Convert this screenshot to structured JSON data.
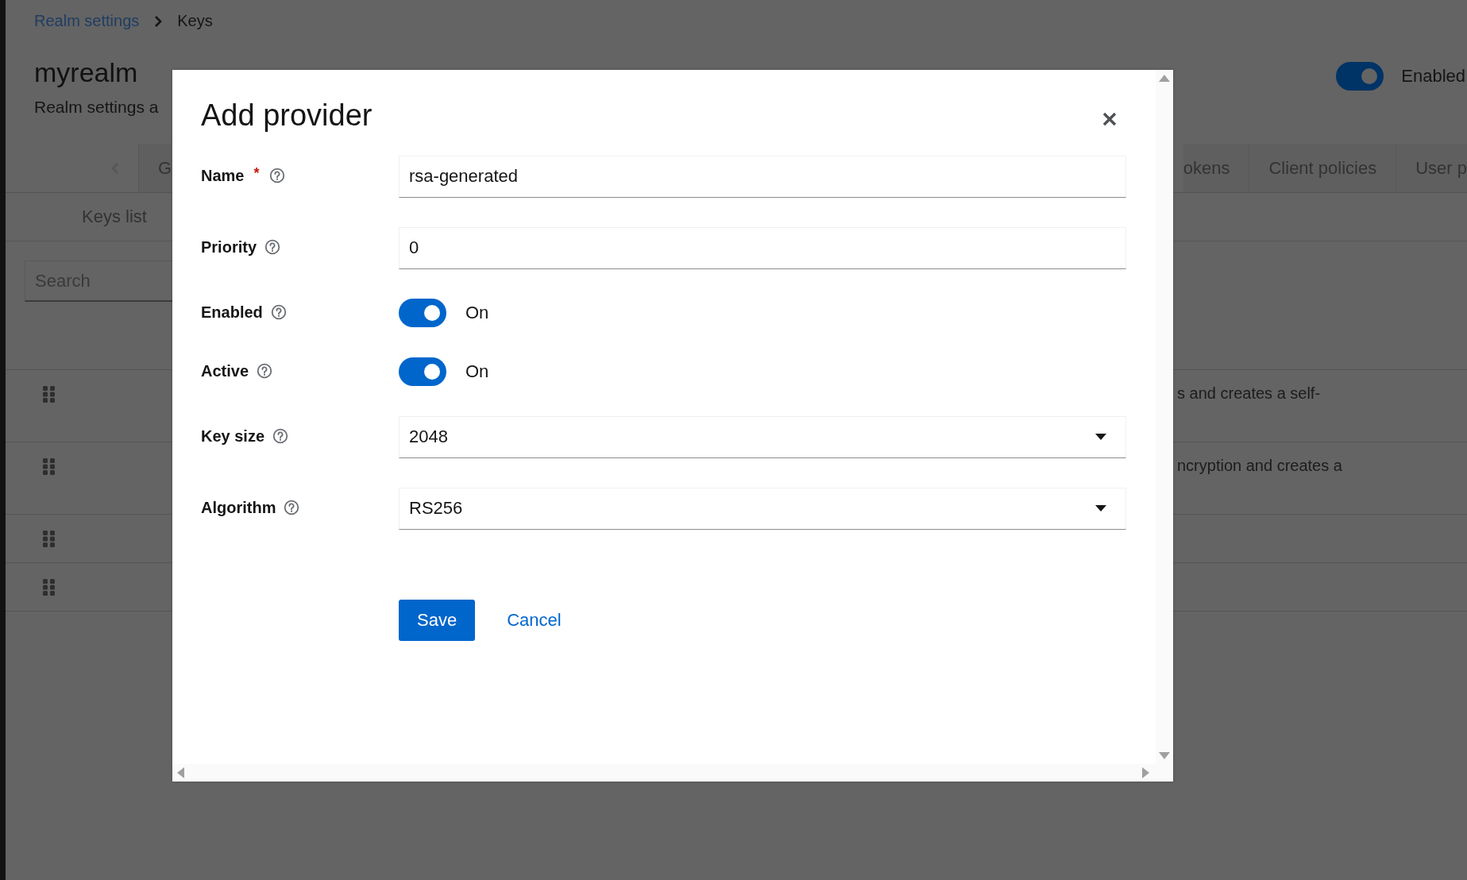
{
  "breadcrumb": [
    {
      "label": "Realm settings",
      "kind": "link"
    },
    {
      "label": "Keys",
      "kind": "current"
    }
  ],
  "header": {
    "title": "myrealm",
    "subtitle": "Realm settings a",
    "toggle": {
      "label": "Enabled",
      "on": true
    }
  },
  "tabs_left": [
    {
      "label": "G"
    }
  ],
  "tabs_right": [
    {
      "label": "okens"
    },
    {
      "label": "Client policies"
    },
    {
      "label": "User p"
    }
  ],
  "subtabs": [
    {
      "label": "Keys list"
    }
  ],
  "search": {
    "placeholder": "Search"
  },
  "rows": [
    {
      "kind": "tall",
      "column_3": "s and creates a self-"
    },
    {
      "kind": "tall",
      "column_3": "ncryption and creates a"
    },
    {
      "kind": "short"
    },
    {
      "kind": "short"
    }
  ],
  "dialog": {
    "title": "Add provider",
    "fields": [
      {
        "kind": "text",
        "label": "Name",
        "required_mark": "*",
        "value": "rsa-generated"
      },
      {
        "kind": "text",
        "label": "Priority",
        "value": "0"
      },
      {
        "kind": "toggle",
        "label": "Enabled",
        "on": true,
        "state_label": "On"
      },
      {
        "kind": "toggle",
        "label": "Active",
        "on": true,
        "state_label": "On"
      },
      {
        "kind": "select",
        "label": "Key size",
        "value": "2048"
      },
      {
        "kind": "select",
        "label": "Algorithm",
        "value": "RS256"
      }
    ],
    "buttons": [
      {
        "kind": "primary",
        "label": "Save"
      },
      {
        "kind": "link",
        "label": "Cancel"
      }
    ]
  }
}
